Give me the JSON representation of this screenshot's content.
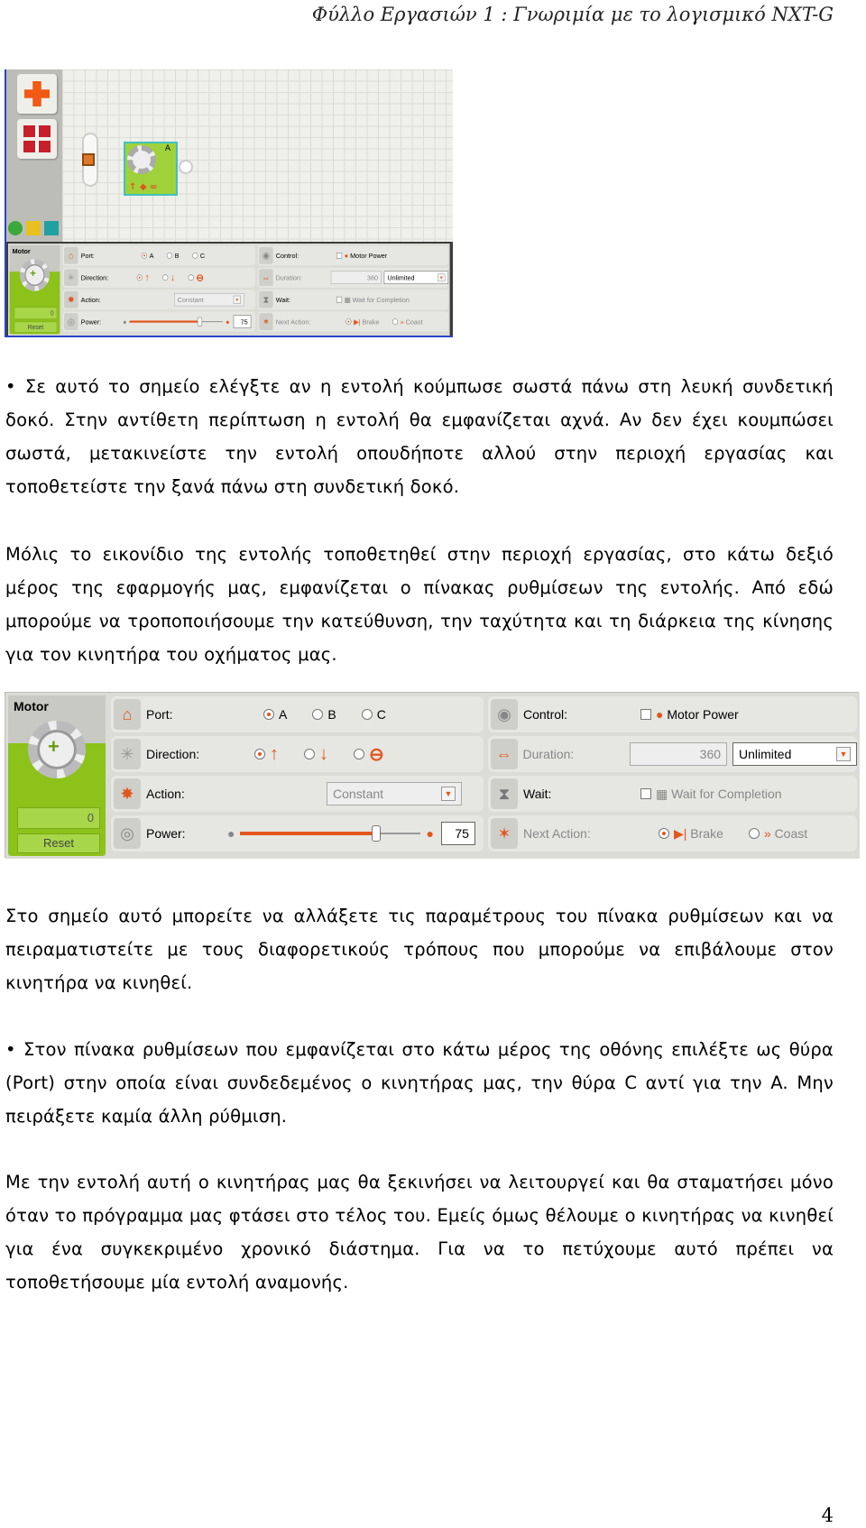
{
  "header": "Φύλλο Εργασιών 1 : Γνωριμία  με το λογισμικό NXT-G",
  "paragraphs": [
    "• Σε αυτό το σημείο ελέγξτε αν η εντολή κούμπωσε σωστά πάνω στη λευκή συνδετική δοκό. Στην αντίθετη περίπτωση η εντολή θα εμφανίζεται αχνά. Αν δεν έχει κουμπώσει σωστά, μετακινείστε την εντολή οπουδήποτε αλλού στην περιοχή εργασίας και τοποθετείστε την ξανά πάνω στη συνδετική δοκό.",
    "Μόλις το εικονίδιο της εντολής τοποθετηθεί στην περιοχή εργασίας, στο κάτω δεξιό μέρος της εφαρμογής μας, εμφανίζεται ο πίνακας ρυθμίσεων της εντολής. Από εδώ μπορούμε να τροποποιήσουμε την κατεύθυνση, την ταχύτητα και τη διάρκεια της κίνησης για τον κινητήρα του οχήματος μας.",
    "Στο σημείο αυτό μπορείτε να αλλάξετε τις παραμέτρους του πίνακα ρυθμίσεων και να πειραματιστείτε με τους διαφορετικούς τρόπους που μπορούμε να επιβάλουμε στον κινητήρα να κινηθεί.",
    "• Στον πίνακα ρυθμίσεων που εμφανίζεται στο κάτω μέρος της οθόνης επιλέξτε ως θύρα (Port) στην οποία είναι συνδεδεμένος ο κινητήρας μας, την θύρα C αντί για την A. Μην πειράξετε καμία άλλη ρύθμιση.",
    "Με την εντολή αυτή ο κινητήρας μας θα ξεκινήσει να λειτουργεί και θα σταματήσει μόνο όταν το πρόγραμμα μας φτάσει στο τέλος του. Εμείς όμως θέλουμε ο κινητήρας να κινηθεί για ένα συγκεκριμένο χρονικό διάστημα. Για να το πετύχουμε αυτό πρέπει να τοποθετήσουμε μία εντολή αναμονής."
  ],
  "canvas": {
    "block_port": "A"
  },
  "panel": {
    "title": "Motor",
    "counter": "0",
    "reset": "Reset",
    "port_label": "Port:",
    "ports": [
      "A",
      "B",
      "C"
    ],
    "port_selected": "A",
    "direction_label": "Direction:",
    "direction_selected": "forward",
    "action_label": "Action:",
    "action_value": "Constant",
    "power_label": "Power:",
    "power_value": "75",
    "control_label": "Control:",
    "control_option": "Motor Power",
    "duration_label": "Duration:",
    "duration_value": "360",
    "duration_unit": "Unlimited",
    "wait_label": "Wait:",
    "wait_option": "Wait for Completion",
    "next_label": "Next Action:",
    "brake": "Brake",
    "coast": "Coast",
    "accent": "#e2561c",
    "green": "#8cc21a"
  },
  "page_number": "4"
}
